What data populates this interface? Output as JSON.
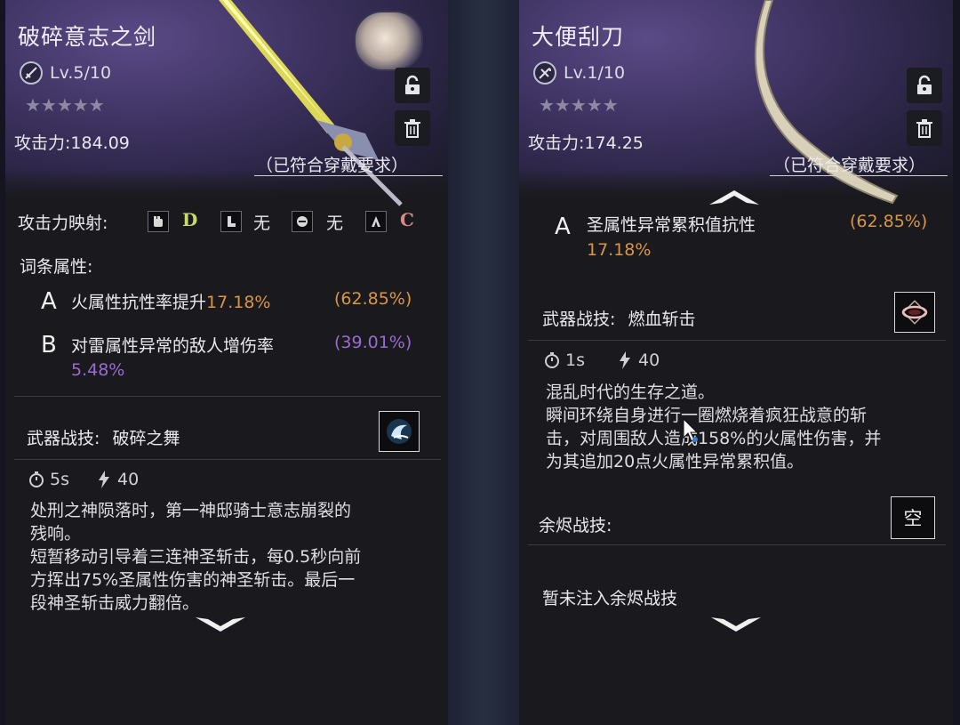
{
  "left": {
    "name": "破碎意志之剑",
    "level": "Lv.5/10",
    "stars": "★★★★★",
    "attack": "攻击力:184.09",
    "requirement": "（已符合穿戴要求）",
    "scaling_label": "攻击力映射:",
    "scaling": [
      {
        "icon": "fist-icon",
        "grade": "D"
      },
      {
        "icon": "boot-icon",
        "grade": "无"
      },
      {
        "icon": "head-icon",
        "grade": "无"
      },
      {
        "icon": "hands-icon",
        "grade": "C"
      }
    ],
    "affix_label": "词条属性:",
    "affixes": [
      {
        "letter": "A",
        "text": "火属性抗性率提升",
        "value": "17.18%",
        "range": "(62.85%)"
      },
      {
        "letter": "B",
        "text": "对雷属性异常的敌人增伤率",
        "value": "5.48%",
        "range": "(39.01%)"
      }
    ],
    "skill_label": "武器战技:",
    "skill_name": "破碎之舞",
    "cooldown": "5s",
    "cost": "40",
    "description": [
      "处刑之神陨落时，第一神邸骑士意志崩裂的",
      "残响。",
      "短暂移动引导着三连神圣斩击，每0.5秒向前",
      "方挥出75%圣属性伤害的神圣斩击。最后一",
      "段神圣斩击威力翻倍。"
    ]
  },
  "right": {
    "name": "大便刮刀",
    "level": "Lv.1/10",
    "stars": "★★★★★",
    "attack": "攻击力:174.25",
    "requirement": "（已符合穿戴要求）",
    "affix": {
      "letter": "A",
      "text": "圣属性异常累积值抗性",
      "value": "17.18%",
      "range": "(62.85%)"
    },
    "skill_label": "武器战技:",
    "skill_name": "燃血斩击",
    "cooldown": "1s",
    "cost": "40",
    "description": [
      "混乱时代的生存之道。",
      "瞬间环绕自身进行一圈燃烧着疯狂战意的斩",
      "击，对周围敌人造成158%的火属性伤害，并",
      "为其追加20点火属性异常累积值。"
    ],
    "ember_label": "余烬战技:",
    "ember_slot": "空",
    "ember_empty": "暂未注入余烬战技"
  },
  "colors": {
    "affix_value": "#d99546",
    "affix_purple": "#9a6bd2",
    "grade_D": "#c9d96a",
    "grade_C": "#d98a86"
  }
}
